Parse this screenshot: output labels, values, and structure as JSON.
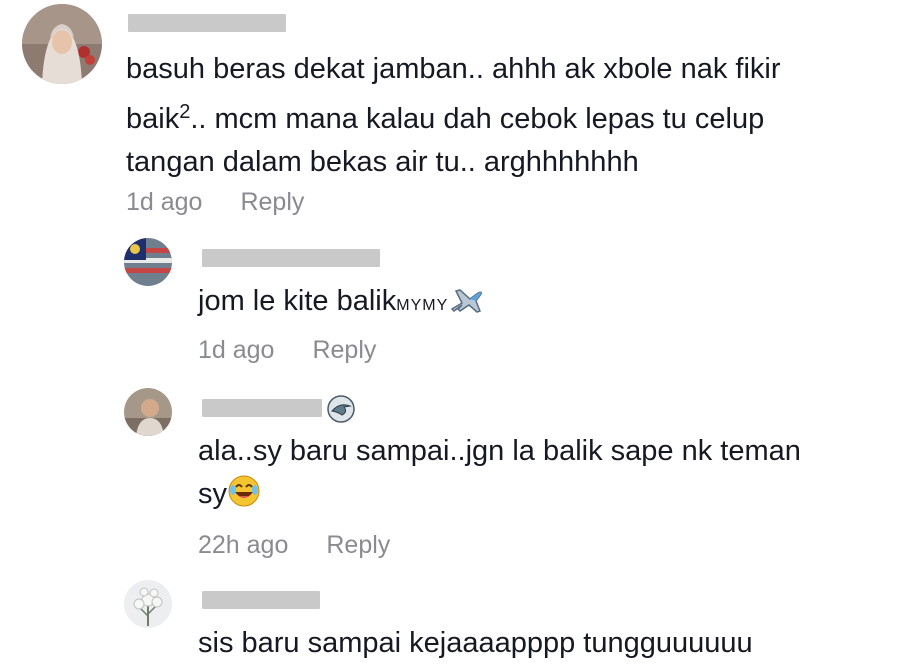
{
  "comments": [
    {
      "username": "",
      "text_lines": [
        "basuh beras dekat jamban.. ahhh ak xbole nak fikir",
        "baik",
        ".. mcm mana kalau dah cebok lepas tu celup",
        "tangan dalam bekas air tu.. arghhhhhhh"
      ],
      "superscript": "2",
      "time": "1d ago",
      "reply_label": "Reply",
      "avatar_icon": "woman-hijab-avatar"
    },
    {
      "username": "",
      "text": "jom le kite balik",
      "flags_text": "MYMY",
      "emoji_icon": "airplane-icon",
      "time": "1d ago",
      "reply_label": "Reply",
      "avatar_icon": "flag-avatar"
    },
    {
      "username": "",
      "username_emoji_icon": "shark-icon",
      "text_lines": [
        "ala..sy baru sampai..jgn la balik sape nk teman",
        "sy"
      ],
      "emoji_icon": "laughing-crying-icon",
      "time": "22h ago",
      "reply_label": "Reply",
      "avatar_icon": "person-avatar"
    },
    {
      "username": "",
      "text": "sis baru sampai kejaaaapppp tungguuuuuu",
      "avatar_icon": "flower-avatar"
    }
  ],
  "colors": {
    "text": "#161823",
    "meta": "#8a8b91",
    "redaction": "#c9c9c9"
  }
}
